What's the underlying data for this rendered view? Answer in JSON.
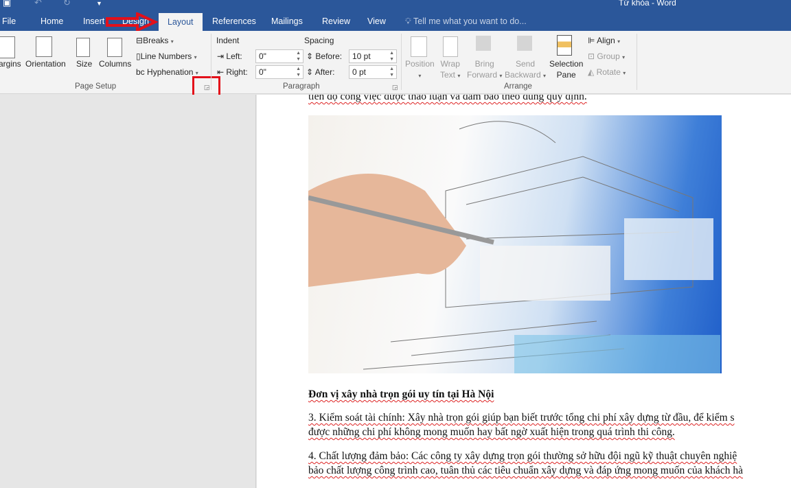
{
  "window": {
    "title": "Từ khóa - Word"
  },
  "qat": {
    "save_icon": "save-icon",
    "undo_icon": "undo-icon",
    "redo_icon": "redo-icon",
    "customize_icon": "chevron-down-icon"
  },
  "tabs": [
    {
      "label": "File"
    },
    {
      "label": "Home"
    },
    {
      "label": "Insert"
    },
    {
      "label": "Design"
    },
    {
      "label": "Layout",
      "active": true
    },
    {
      "label": "References"
    },
    {
      "label": "Mailings"
    },
    {
      "label": "Review"
    },
    {
      "label": "View"
    }
  ],
  "tell_me": {
    "placeholder": "Tell me what you want to do..."
  },
  "page_setup": {
    "group": "Page Setup",
    "margins": "argins",
    "orientation": "Orientation",
    "size": "Size",
    "columns": "Columns",
    "breaks": "Breaks",
    "line_numbers": "Line Numbers",
    "hyphenation": "Hyphenation"
  },
  "paragraph": {
    "group": "Paragraph",
    "indent": "Indent",
    "spacing": "Spacing",
    "left_label": "Left:",
    "left_value": "0\"",
    "right_label": "Right:",
    "right_value": "0\"",
    "before_label": "Before:",
    "before_value": "10 pt",
    "after_label": "After:",
    "after_value": "0 pt"
  },
  "arrange": {
    "group": "Arrange",
    "position": "Position",
    "wrap1": "Wrap",
    "wrap2": "Text",
    "bring1": "Bring",
    "bring2": "Forward",
    "send1": "Send",
    "send2": "Backward",
    "sel1": "Selection",
    "sel2": "Pane",
    "align": "Align",
    "group_btn": "Group",
    "rotate": "Rotate"
  },
  "annotation_color": "#e3101a",
  "document": {
    "line0": "tiến độ công việc được thảo luận và đảm bảo theo đúng quy định.",
    "heading": "Đơn vị xây nhà trọn gói uy tín tại Hà Nội",
    "p3a": "3. Kiểm soát tài chính: Xây nhà trọn gói giúp bạn biết trước tổng chi phí xây dựng từ đầu, để kiểm s",
    "p3b": "được những chi phí không mong muốn hay bất ngờ xuất hiện trong quá trình thi công.",
    "p4a": "4. Chất lượng đảm bảo: Các công ty xây dựng trọn gói thường sở hữu đội ngũ kỹ thuật chuyên nghiệ",
    "p4b": "bảo chất lượng công trình cao, tuân thủ các tiêu chuẩn xây dựng và đáp ứng mong muốn của khách hà"
  }
}
